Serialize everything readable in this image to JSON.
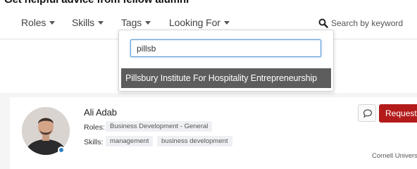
{
  "page_header": {
    "title_fragment": "Get helpful advice from fellow alumni"
  },
  "filters": {
    "roles": "Roles",
    "skills": "Skills",
    "tags": "Tags",
    "looking_for": "Looking For"
  },
  "search": {
    "icon": "search-icon",
    "placeholder": "Search by keyword"
  },
  "tags_dropdown": {
    "input_value": "pillsb",
    "suggestions": [
      "Pillsbury Institute For Hospitality Entrepreneurship"
    ]
  },
  "person": {
    "name": "Ali Adab",
    "roles_label": "Roles:",
    "roles": [
      "Business Development - General"
    ],
    "skills_label": "Skills:",
    "skills": [
      "management",
      "business development"
    ],
    "organization": "Cornell University",
    "message_icon": "chat-bubble-icon",
    "request_label": "Request"
  },
  "colors": {
    "request_button": "#b31b1b",
    "suggestion_highlight": "#5d5d5d",
    "input_focus": "#5b9bd5",
    "page_background": "#f5f5f6"
  }
}
